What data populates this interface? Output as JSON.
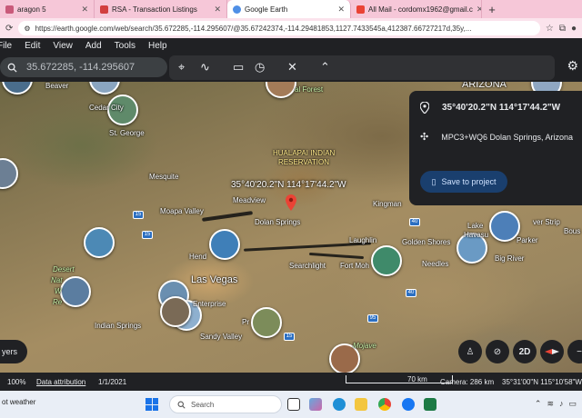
{
  "browser": {
    "tabs": [
      {
        "title": "aragon 5",
        "active": false,
        "fav_color": "#c95a7a"
      },
      {
        "title": "RSA - Transaction Listings",
        "active": false,
        "fav_color": "#d23f3f"
      },
      {
        "title": "Google Earth",
        "active": true,
        "fav_color": "#4f8fe6"
      },
      {
        "title": "All Mail - cordomx1962@gmail.c",
        "active": false,
        "fav_color": "#ea4335"
      }
    ],
    "url": "https://earth.google.com/web/search/35.672285,-114.295607/@35.67242374,-114.29481853,1127.7433545a,412387.66727217d,35y,..."
  },
  "menu": [
    "File",
    "Edit",
    "View",
    "Add",
    "Tools",
    "Help"
  ],
  "search": {
    "value": "35.672285, -114.295607"
  },
  "map": {
    "coordinate_label": "35°40'20.2\"N 114°17'44.2\"W",
    "places": [
      {
        "name": "Beaver",
        "style": ""
      },
      {
        "name": "Cedar City",
        "style": ""
      },
      {
        "name": "St. George",
        "style": ""
      },
      {
        "name": "Mesquite",
        "style": ""
      },
      {
        "name": "Moapa Valley",
        "style": ""
      },
      {
        "name": "Meadview",
        "style": ""
      },
      {
        "name": "Dolan Springs",
        "style": ""
      },
      {
        "name": "Kingman",
        "style": ""
      },
      {
        "name": "Laughlin",
        "style": ""
      },
      {
        "name": "Golden Shores",
        "style": ""
      },
      {
        "name": "Lake",
        "style": ""
      },
      {
        "name": "Havasu",
        "style": ""
      },
      {
        "name": "Parker",
        "style": ""
      },
      {
        "name": "Big River",
        "style": ""
      },
      {
        "name": "Needles",
        "style": ""
      },
      {
        "name": "Fort Moh",
        "style": ""
      },
      {
        "name": "Searchlight",
        "style": ""
      },
      {
        "name": "Las Vegas",
        "style": "big"
      },
      {
        "name": "Hend",
        "style": ""
      },
      {
        "name": "Enterprise",
        "style": ""
      },
      {
        "name": "Indian Springs",
        "style": ""
      },
      {
        "name": "Sandy Valley",
        "style": ""
      },
      {
        "name": "Pr",
        "style": ""
      },
      {
        "name": "Desert",
        "style": "green italic"
      },
      {
        "name": "Nat",
        "style": "green italic"
      },
      {
        "name": "W",
        "style": "green italic"
      },
      {
        "name": "Re",
        "style": "green italic"
      },
      {
        "name": "al Forest",
        "style": "green"
      },
      {
        "name": "HUALAPAI INDIAN",
        "style": "yellow"
      },
      {
        "name": "RESERVATION",
        "style": "yellow"
      },
      {
        "name": "ARIZONA",
        "style": "big"
      },
      {
        "name": "ver Strip",
        "style": ""
      },
      {
        "name": "Bous",
        "style": ""
      },
      {
        "name": "Mojave",
        "style": "green italic"
      }
    ],
    "highways": [
      "15",
      "15",
      "40",
      "40",
      "15",
      "95"
    ]
  },
  "info_panel": {
    "coordinates": "35°40'20.2\"N 114°17'44.2\"W",
    "plus_code": "MPC3+WQ6 Dolan Springs, Arizona",
    "save_label": "Save to project"
  },
  "controls": {
    "layers": "yers",
    "view_mode": "2D"
  },
  "status_bar": {
    "zoom": "100%",
    "attribution": "Data attribution",
    "date": "1/1/2021",
    "scale": "70 km",
    "camera": "Camera: 286 km",
    "coords": "35°31'00\"N 115°10'58\"W"
  },
  "taskbar": {
    "weather": "ot weather",
    "search_placeholder": "Search"
  },
  "colors": {
    "accent": "#1a73e8",
    "pin": "#ea4335"
  }
}
